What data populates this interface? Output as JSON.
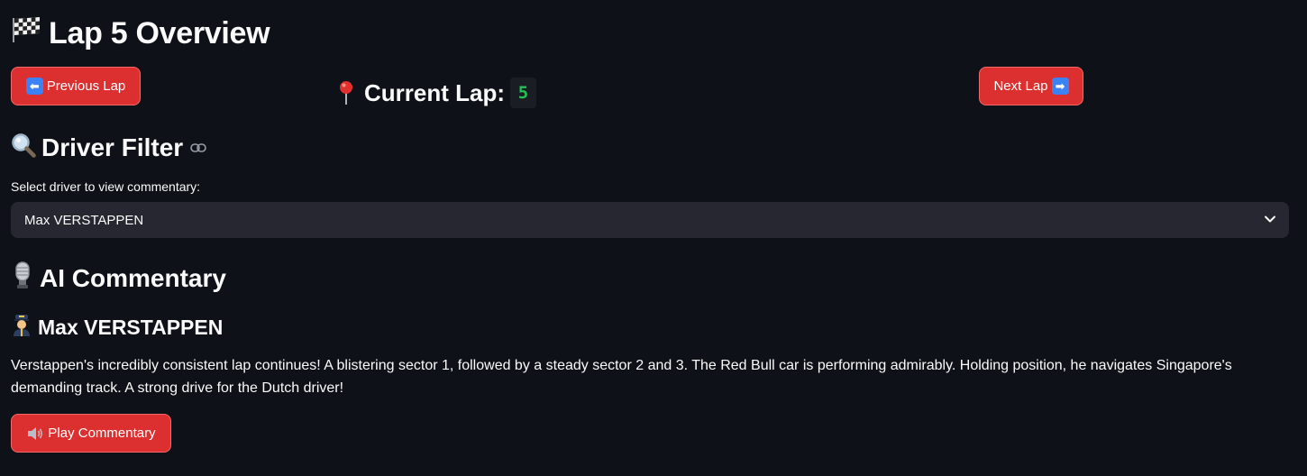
{
  "header": {
    "flag_icon": "chequered-flag-icon",
    "title": "Lap 5 Overview"
  },
  "nav": {
    "previous_label": "Previous Lap",
    "previous_icon": "left-arrow-icon",
    "next_label": "Next Lap",
    "next_icon": "right-arrow-icon",
    "current_lap_label": "Current Lap:",
    "current_lap_icon": "pin-icon",
    "current_lap_value": "5"
  },
  "driver_filter": {
    "icon": "magnifier-icon",
    "heading": "Driver Filter",
    "anchor_icon": "link-icon",
    "select_label": "Select driver to view commentary:",
    "selected_value": "Max VERSTAPPEN"
  },
  "commentary": {
    "icon": "microphone-icon",
    "heading": "AI Commentary",
    "driver_icon": "pilot-icon",
    "driver_name": "Max VERSTAPPEN",
    "text": "Verstappen's incredibly consistent lap continues! A blistering sector 1, followed by a steady sector 2 and 3. The Red Bull car is performing admirably. Holding position, he navigates Singapore's demanding track. A strong drive for the Dutch driver!",
    "play_label": "Play Commentary",
    "play_icon": "speaker-icon"
  },
  "colors": {
    "background": "#0e1117",
    "button": "#dc2f2f",
    "select_bg": "#262730",
    "lap_value": "#21c354"
  }
}
